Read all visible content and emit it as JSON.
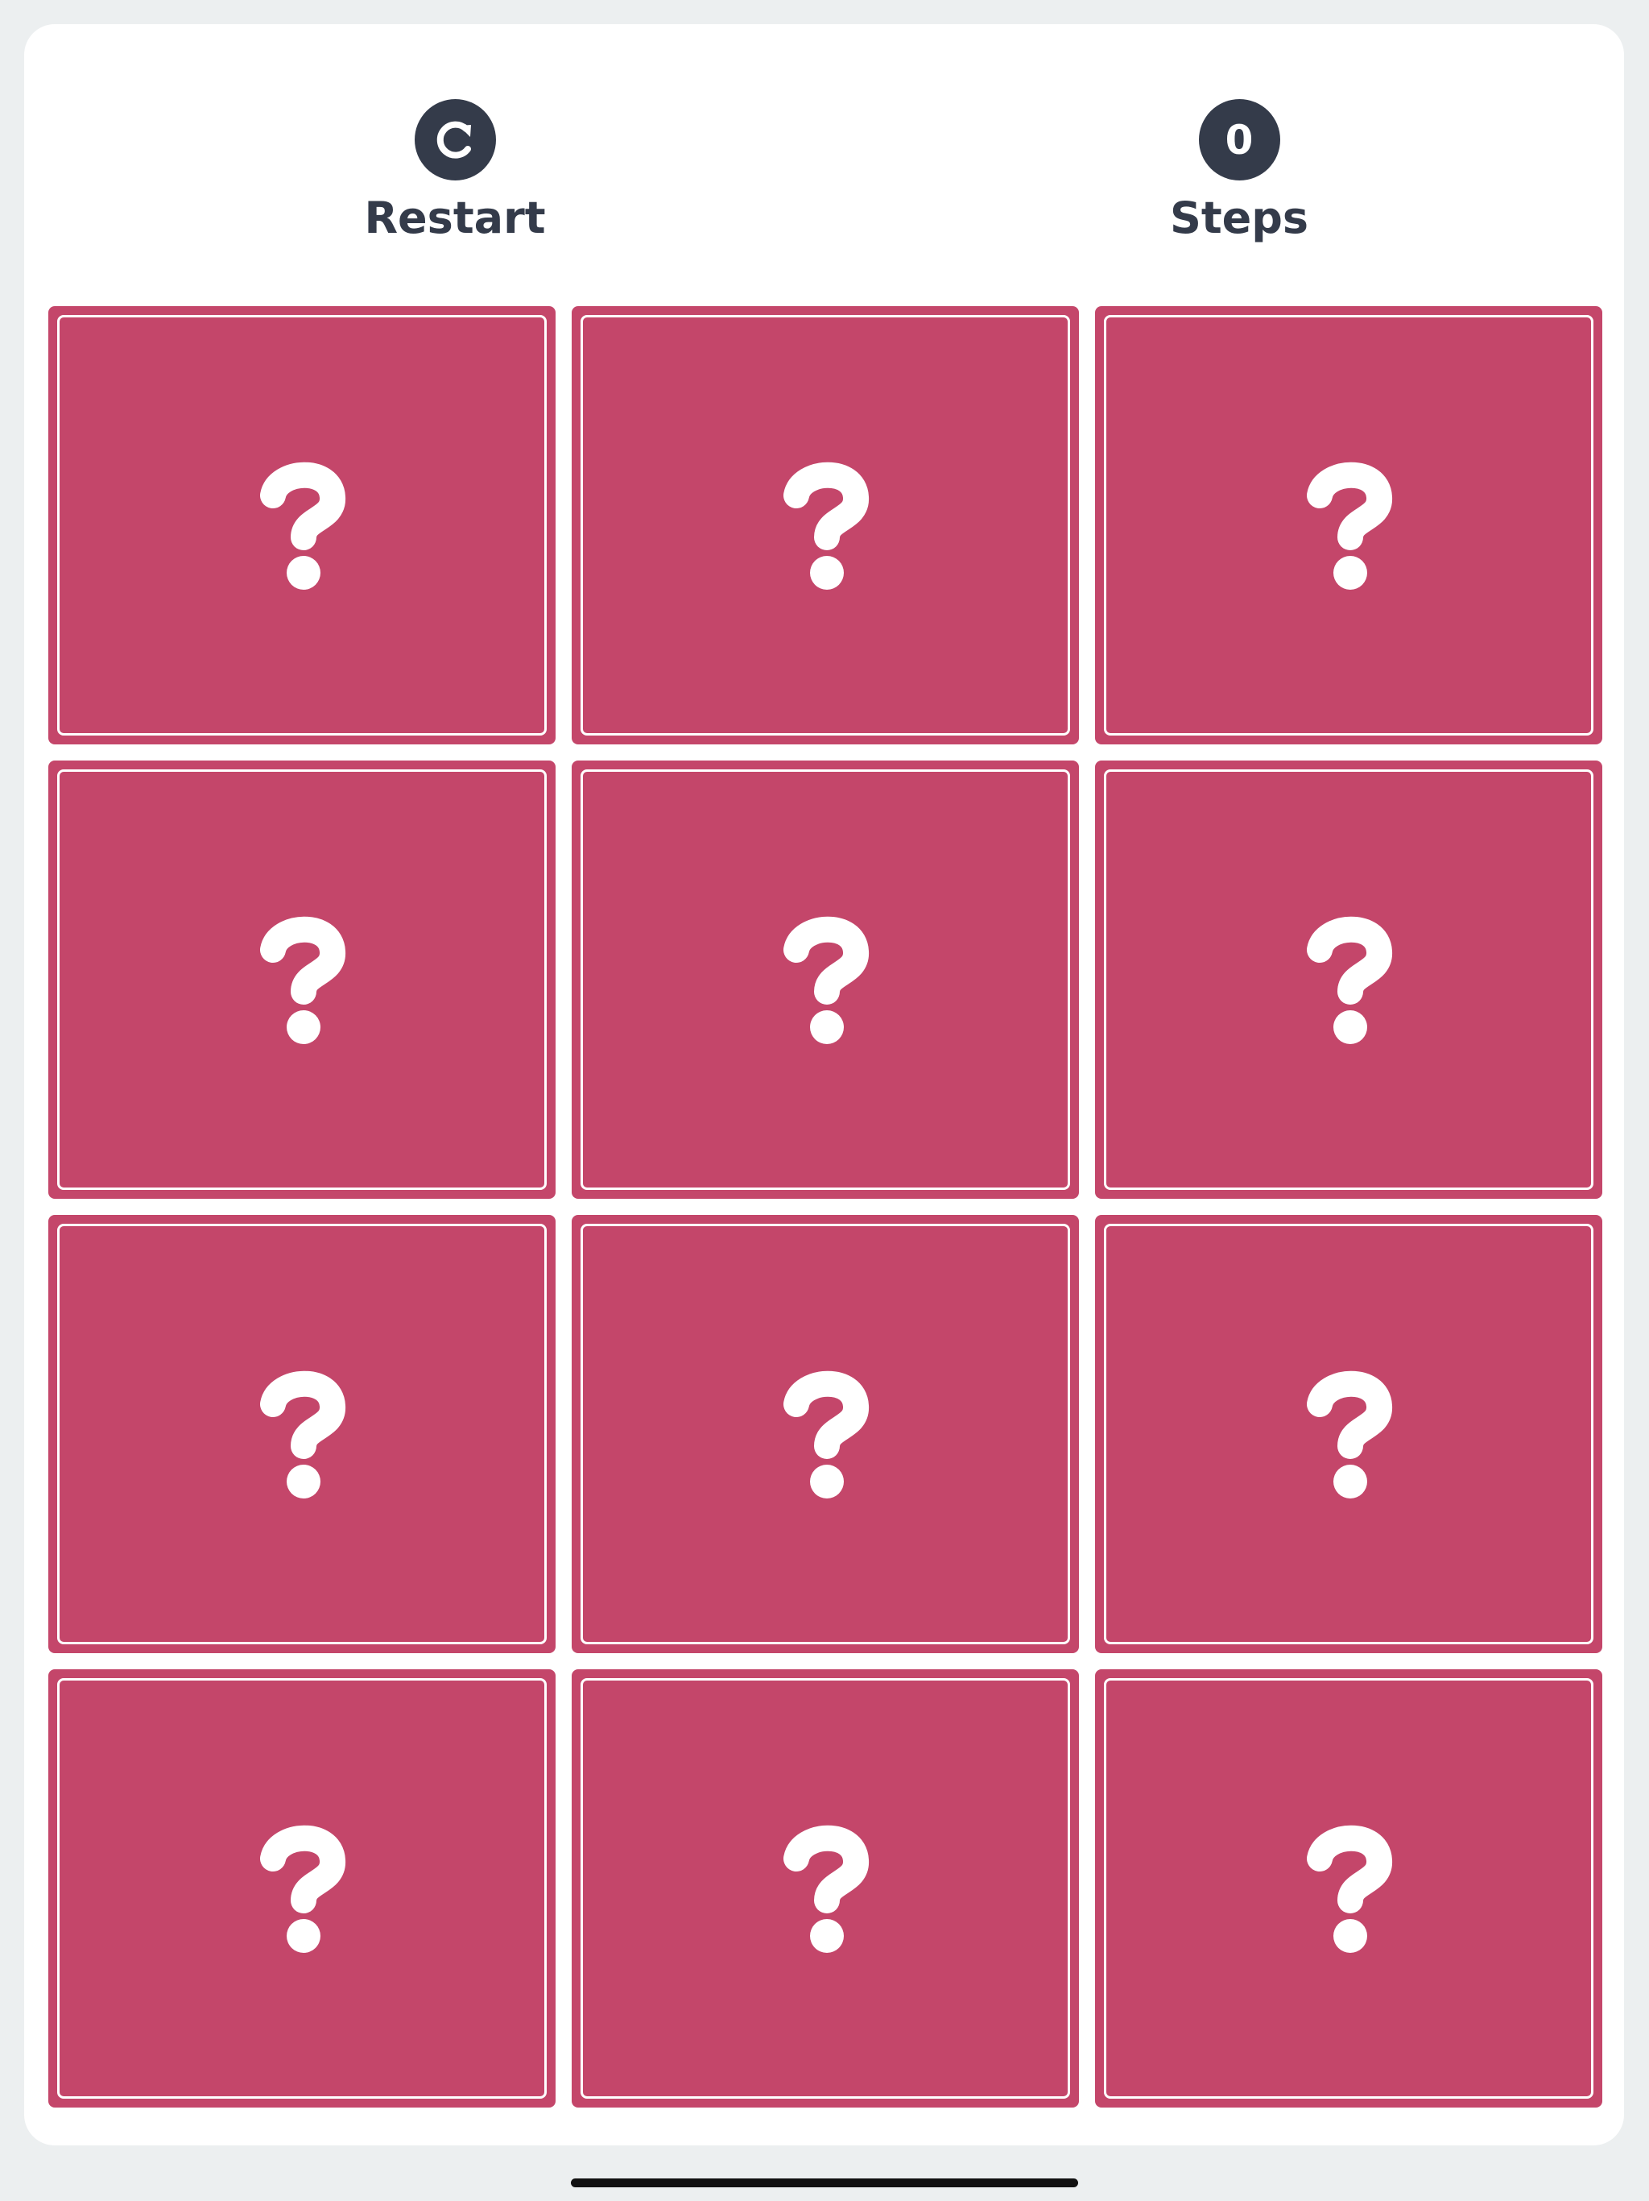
{
  "controls": {
    "restart": {
      "label": "Restart",
      "icon": "restart-icon"
    },
    "steps": {
      "label": "Steps",
      "value": "0"
    }
  },
  "cards": [
    {
      "face": "?",
      "icon": "question-mark-icon",
      "state": "hidden"
    },
    {
      "face": "?",
      "icon": "question-mark-icon",
      "state": "hidden"
    },
    {
      "face": "?",
      "icon": "question-mark-icon",
      "state": "hidden"
    },
    {
      "face": "?",
      "icon": "question-mark-icon",
      "state": "hidden"
    },
    {
      "face": "?",
      "icon": "question-mark-icon",
      "state": "hidden"
    },
    {
      "face": "?",
      "icon": "question-mark-icon",
      "state": "hidden"
    },
    {
      "face": "?",
      "icon": "question-mark-icon",
      "state": "hidden"
    },
    {
      "face": "?",
      "icon": "question-mark-icon",
      "state": "hidden"
    },
    {
      "face": "?",
      "icon": "question-mark-icon",
      "state": "hidden"
    },
    {
      "face": "?",
      "icon": "question-mark-icon",
      "state": "hidden"
    },
    {
      "face": "?",
      "icon": "question-mark-icon",
      "state": "hidden"
    },
    {
      "face": "?",
      "icon": "question-mark-icon",
      "state": "hidden"
    }
  ],
  "colors": {
    "page_background": "#ECEFF0",
    "panel": "#FFFFFF",
    "control_circle": "#343B4A",
    "card_back": "#C4466A",
    "card_border": "#FFFFFF",
    "glyph": "#FFFFFF"
  }
}
